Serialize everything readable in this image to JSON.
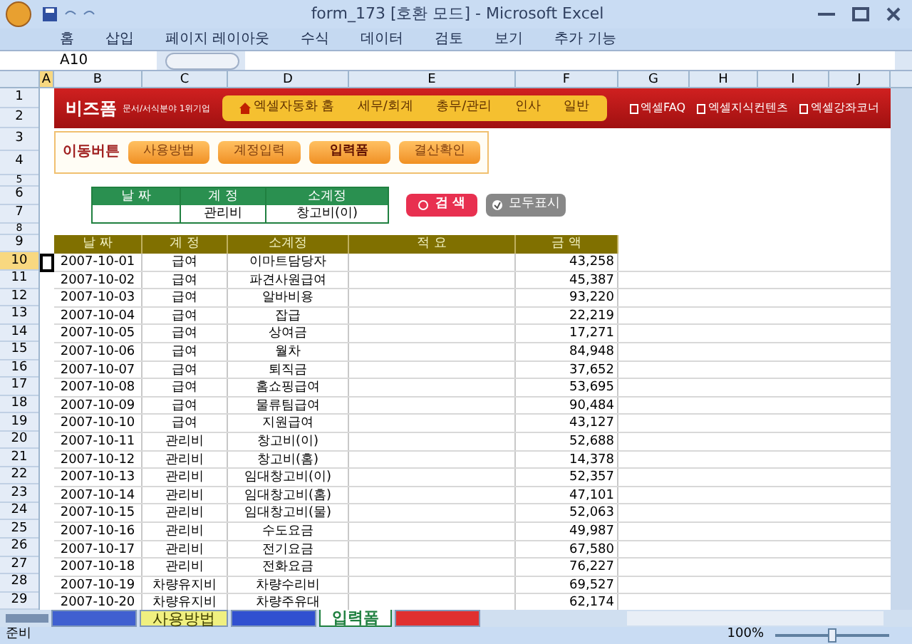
{
  "window": {
    "title": "form_173  [호환 모드] - Microsoft Excel"
  },
  "ribbon_tabs": [
    "홈",
    "삽입",
    "페이지 레이아웃",
    "수식",
    "데이터",
    "검토",
    "보기",
    "추가 기능"
  ],
  "name_box": "A10",
  "columns": [
    {
      "label": "A",
      "selected": true
    },
    {
      "label": "B",
      "selected": false
    },
    {
      "label": "C",
      "selected": false
    },
    {
      "label": "D",
      "selected": false
    },
    {
      "label": "E",
      "selected": false
    },
    {
      "label": "F",
      "selected": false
    },
    {
      "label": "G",
      "selected": false
    },
    {
      "label": "H",
      "selected": false
    },
    {
      "label": "I",
      "selected": false
    },
    {
      "label": "J",
      "selected": false
    }
  ],
  "row_numbers": [
    {
      "label": "1",
      "selected": false
    },
    {
      "label": "2",
      "selected": false
    },
    {
      "label": "3",
      "selected": false
    },
    {
      "label": "4",
      "selected": false
    },
    {
      "label": "5",
      "selected": false
    },
    {
      "label": "6",
      "selected": false
    },
    {
      "label": "7",
      "selected": false
    },
    {
      "label": "8",
      "selected": false
    },
    {
      "label": "9",
      "selected": false
    },
    {
      "label": "10",
      "selected": true
    },
    {
      "label": "11",
      "selected": false
    },
    {
      "label": "12",
      "selected": false
    },
    {
      "label": "13",
      "selected": false
    },
    {
      "label": "14",
      "selected": false
    },
    {
      "label": "15",
      "selected": false
    },
    {
      "label": "16",
      "selected": false
    },
    {
      "label": "17",
      "selected": false
    },
    {
      "label": "18",
      "selected": false
    },
    {
      "label": "19",
      "selected": false
    },
    {
      "label": "20",
      "selected": false
    },
    {
      "label": "21",
      "selected": false
    },
    {
      "label": "22",
      "selected": false
    },
    {
      "label": "23",
      "selected": false
    },
    {
      "label": "24",
      "selected": false
    },
    {
      "label": "25",
      "selected": false
    },
    {
      "label": "26",
      "selected": false
    },
    {
      "label": "27",
      "selected": false
    },
    {
      "label": "28",
      "selected": false
    },
    {
      "label": "29",
      "selected": false
    }
  ],
  "banner": {
    "logo": "비즈폼",
    "logo_sub": "문서/서식분야 1위기업",
    "nav": [
      {
        "label": "엑셀자동화 홈",
        "kind": "home"
      },
      {
        "label": "세무/회계",
        "kind": "plain"
      },
      {
        "label": "총무/관리",
        "kind": "plain"
      },
      {
        "label": "인사",
        "kind": "plain"
      },
      {
        "label": "일반",
        "kind": "plain"
      }
    ],
    "links": [
      "엑셀FAQ",
      "엑셀지식컨텐츠",
      "엑셀강좌코너"
    ]
  },
  "move_bar": {
    "label": "이동버튼",
    "buttons": [
      {
        "label": "사용방법",
        "selected": false
      },
      {
        "label": "계정입력",
        "selected": false
      },
      {
        "label": "입력폼",
        "selected": true
      },
      {
        "label": "결산확인",
        "selected": false
      }
    ]
  },
  "filter": {
    "fields": [
      {
        "label": "날 짜"
      },
      {
        "label": "계 정",
        "value": "관리비"
      },
      {
        "label": "소계정",
        "value": "창고비(이)"
      }
    ],
    "search_button": "검 색",
    "show_all_button": "모두표시"
  },
  "table": {
    "columns": [
      "날 짜",
      "계 정",
      "소계정",
      "적 요",
      "금 액"
    ],
    "rows": [
      {
        "date": "2007-10-01",
        "account": "급여",
        "sub": "이마트담당자",
        "amount": "43,258"
      },
      {
        "date": "2007-10-02",
        "account": "급여",
        "sub": "파견사원급여",
        "amount": "45,387"
      },
      {
        "date": "2007-10-03",
        "account": "급여",
        "sub": "알바비용",
        "amount": "93,220"
      },
      {
        "date": "2007-10-04",
        "account": "급여",
        "sub": "잡급",
        "amount": "22,219"
      },
      {
        "date": "2007-10-05",
        "account": "급여",
        "sub": "상여금",
        "amount": "17,271"
      },
      {
        "date": "2007-10-06",
        "account": "급여",
        "sub": "월차",
        "amount": "84,948"
      },
      {
        "date": "2007-10-07",
        "account": "급여",
        "sub": "퇴직금",
        "amount": "37,652"
      },
      {
        "date": "2007-10-08",
        "account": "급여",
        "sub": "홈쇼핑급여",
        "amount": "53,695"
      },
      {
        "date": "2007-10-09",
        "account": "급여",
        "sub": "물류팀급여",
        "amount": "90,484"
      },
      {
        "date": "2007-10-10",
        "account": "급여",
        "sub": "지원급여",
        "amount": "43,127"
      },
      {
        "date": "2007-10-11",
        "account": "관리비",
        "sub": "창고비(이)",
        "amount": "52,688"
      },
      {
        "date": "2007-10-12",
        "account": "관리비",
        "sub": "창고비(홈)",
        "amount": "14,378"
      },
      {
        "date": "2007-10-13",
        "account": "관리비",
        "sub": "임대창고비(이)",
        "amount": "52,357"
      },
      {
        "date": "2007-10-14",
        "account": "관리비",
        "sub": "임대창고비(홈)",
        "amount": "47,101"
      },
      {
        "date": "2007-10-15",
        "account": "관리비",
        "sub": "임대창고비(물)",
        "amount": "52,063"
      },
      {
        "date": "2007-10-16",
        "account": "관리비",
        "sub": "수도요금",
        "amount": "49,987"
      },
      {
        "date": "2007-10-17",
        "account": "관리비",
        "sub": "전기요금",
        "amount": "67,580"
      },
      {
        "date": "2007-10-18",
        "account": "관리비",
        "sub": "전화요금",
        "amount": "76,227"
      },
      {
        "date": "2007-10-19",
        "account": "차량유지비",
        "sub": "차량수리비",
        "amount": "69,527"
      },
      {
        "date": "2007-10-20",
        "account": "차량유지비",
        "sub": "차량주유대",
        "amount": "62,174"
      }
    ]
  },
  "sheet_tabs": [
    {
      "color": "#4060d0",
      "selected": false
    },
    {
      "label": "사용방법",
      "color": "#f0f080",
      "selected": false
    },
    {
      "color": "#3050d0",
      "selected": false
    },
    {
      "label": "입력폼",
      "color": "#ffffff",
      "selected": true
    },
    {
      "color": "#e03030",
      "selected": false
    }
  ],
  "status_bar": {
    "text": "준비",
    "zoom": "100%",
    "zoom_slider": {
      "level": 0.5
    }
  }
}
